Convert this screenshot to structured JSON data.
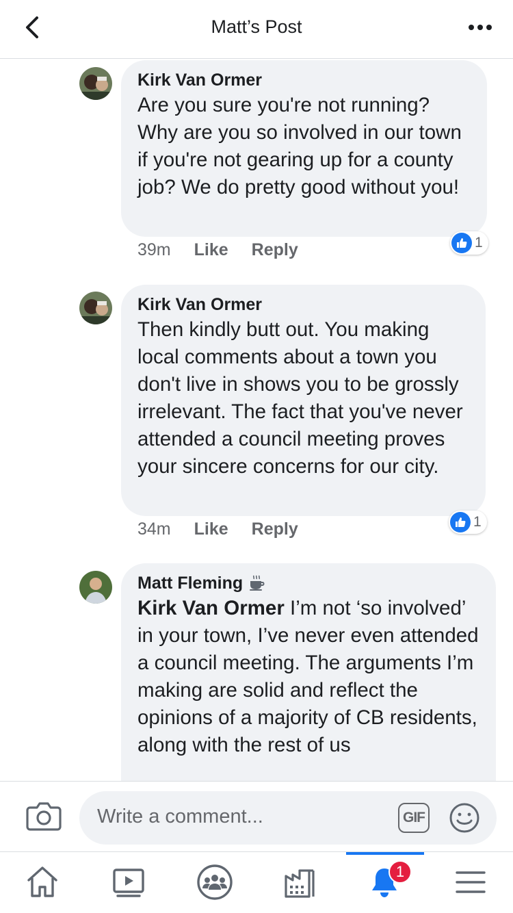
{
  "header": {
    "title": "Matt’s Post"
  },
  "comments": [
    {
      "author": "Kirk Van Ormer",
      "text": "Are you sure you're not running? Why are you so involved in our town if you're not gearing up for a county job? We do pretty good without you!",
      "time": "39m",
      "like_label": "Like",
      "reply_label": "Reply",
      "reaction_count": "1"
    },
    {
      "author": "Kirk Van Ormer",
      "text": "Then kindly butt out. You making local comments about a town you don't live in shows you to be grossly irrelevant. The fact that you've never attended a council meeting proves your sincere concerns for our city.",
      "time": "34m",
      "like_label": "Like",
      "reply_label": "Reply",
      "reaction_count": "1"
    },
    {
      "author": "Matt Fleming",
      "author_badge_icon": "coffee-cup-icon",
      "mention": "Kirk Van Ormer",
      "text": "Kirk Van Ormer I’m not ‘so involved’ in your town, I’ve never even attended a council meeting. The arguments I’m making are solid and reflect the opinions of a majority of CB residents, along with the rest of us"
    }
  ],
  "composer": {
    "placeholder": "Write a comment...",
    "gif_label": "GIF"
  },
  "tabbar": {
    "notification_count": "1",
    "active_tab": "notifications"
  },
  "colors": {
    "accent": "#1877f2",
    "bubble": "#f0f2f5",
    "badge": "#e41e3f",
    "secondary_text": "#65676b"
  }
}
